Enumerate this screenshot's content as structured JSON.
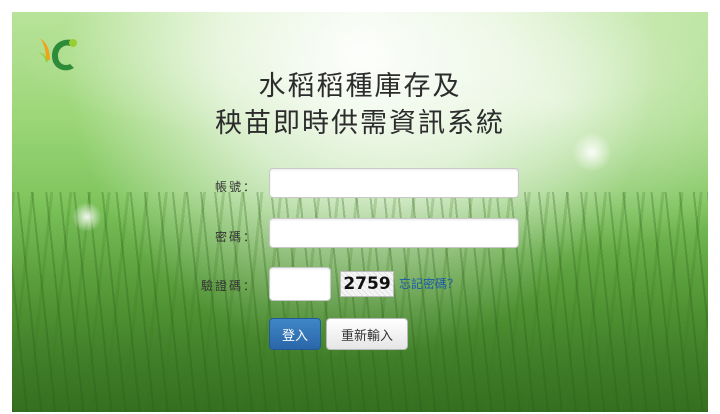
{
  "header": {
    "title_line1": "水稻稻種庫存及",
    "title_line2": "秧苗即時供需資訊系統",
    "logo_icon": "leaf-logo-icon"
  },
  "form": {
    "account_label": "帳號：",
    "account_value": "",
    "password_label": "密碼：",
    "password_value": "",
    "captcha_label": "驗證碼：",
    "captcha_value": "",
    "captcha_code": "2759",
    "forgot_link": "忘記密碼？"
  },
  "buttons": {
    "login": "登入",
    "reset": "重新輸入"
  },
  "colors": {
    "login_button": "#2a66a8",
    "link": "#1b5aa8",
    "logo_green": "#2e8b3a",
    "logo_orange": "#f2a21a",
    "logo_lime": "#9acd32"
  }
}
